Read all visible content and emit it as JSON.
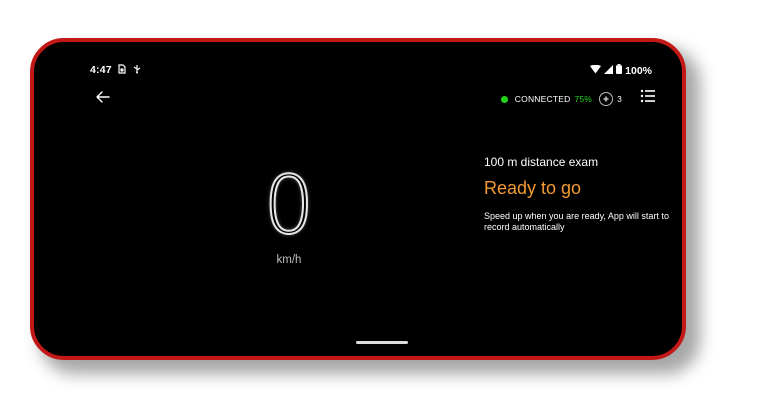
{
  "status_bar": {
    "time": "4:47",
    "battery": "100%",
    "icons": [
      "sim-icon",
      "usb-icon",
      "wifi-icon",
      "signal-icon",
      "battery-icon"
    ]
  },
  "toolbar": {
    "back_icon": "arrow-left-icon",
    "connection_label": "CONNECTED",
    "connection_percent": "75%",
    "connection_status_color": "#22d418",
    "satellite_count": "3",
    "menu_icon": "list-icon"
  },
  "speedometer": {
    "value": "0",
    "unit": "km/h"
  },
  "exam": {
    "title": "100 m distance exam",
    "status": "Ready to go",
    "status_color": "#f19b33",
    "hint": "Speed up when you are ready, App will start to record automatically"
  },
  "colors": {
    "frame": "#c31818",
    "background": "#000000"
  }
}
